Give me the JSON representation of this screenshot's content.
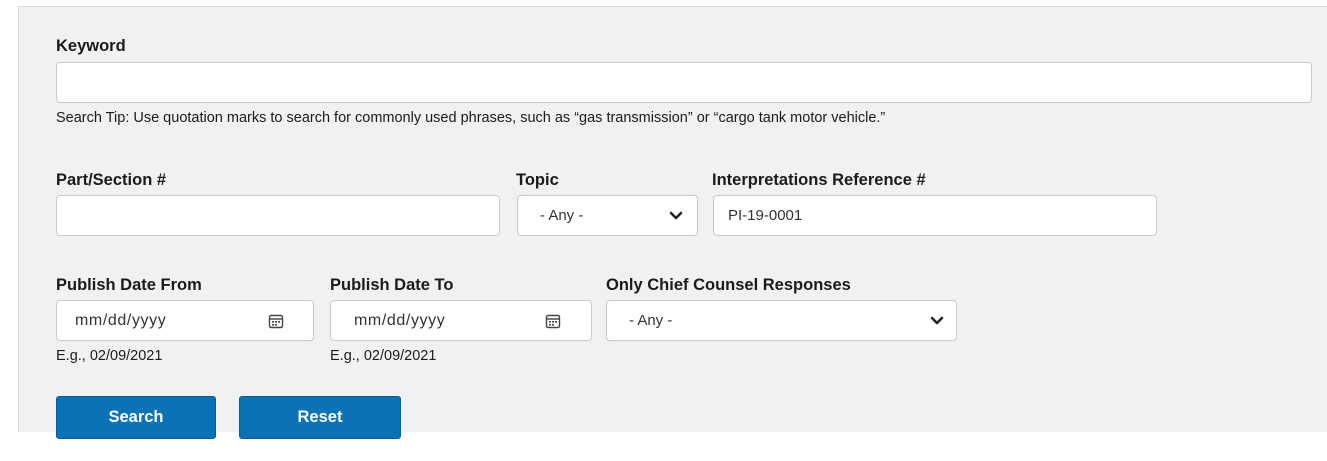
{
  "keyword": {
    "label": "Keyword",
    "value": "",
    "tip": "Search Tip: Use quotation marks to search for commonly used phrases, such as “gas transmission” or “cargo tank motor vehicle.”"
  },
  "part_section": {
    "label": "Part/Section #",
    "value": ""
  },
  "topic": {
    "label": "Topic",
    "selected": "- Any -"
  },
  "reference": {
    "label": "Interpretations Reference #",
    "value": "PI-19-0001"
  },
  "publish_from": {
    "label": "Publish Date From",
    "placeholder": "mm/dd/yyyy",
    "hint": "E.g., 02/09/2021"
  },
  "publish_to": {
    "label": "Publish Date To",
    "placeholder": "mm/dd/yyyy",
    "hint": "E.g., 02/09/2021"
  },
  "chief_counsel": {
    "label": "Only Chief Counsel Responses",
    "selected": "- Any -"
  },
  "buttons": {
    "search": "Search",
    "reset": "Reset"
  },
  "colors": {
    "panel_bg": "#f1f1f1",
    "button_bg": "#0a73b8",
    "border": "#c9c9c9"
  },
  "icons": {
    "date_picker": "calendar-icon",
    "dropdown": "chevron-down-icon"
  }
}
